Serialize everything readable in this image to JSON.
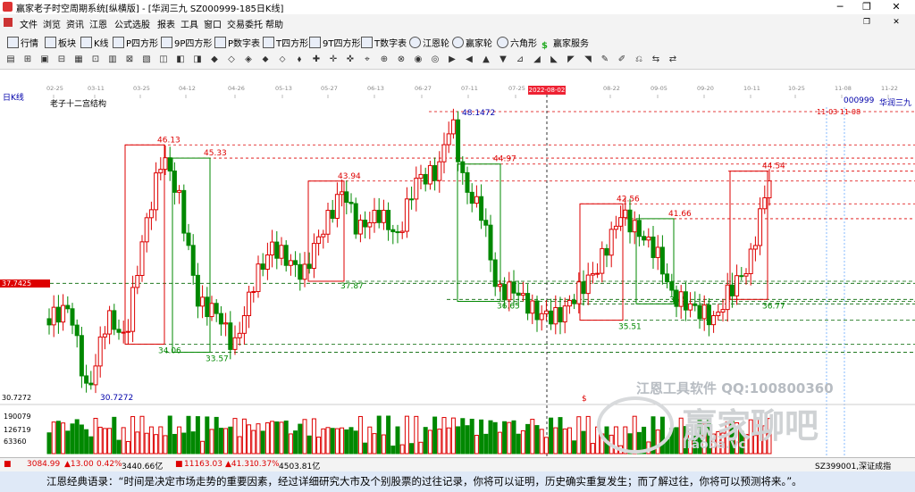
{
  "window": {
    "title": "赢家老子时空周期系统[纵横版] - [华润三九  SZ000999-185日K线]",
    "min_label": "─",
    "restore_label": "❐",
    "close_label": "✕"
  },
  "menu": [
    "文件",
    "浏览",
    "资讯",
    "江恩",
    "公式选股",
    "报表",
    "工具",
    "窗口",
    "交易委托",
    "帮助"
  ],
  "toolbar1": [
    "行情",
    "板块",
    "K线",
    "P四方形",
    "9P四方形",
    "P数字表",
    "T四方形",
    "9T四方形",
    "T数字表",
    "江恩轮",
    "赢家轮",
    "六角形",
    "赢家服务"
  ],
  "toolbar2_icons": [
    "grid-icon",
    "circle-icon",
    "square-icon",
    "digit-icon",
    "chart-icon",
    "cross-icon"
  ],
  "dates": [
    {
      "label": "02-25",
      "x": 60
    },
    {
      "label": "03-11",
      "x": 106
    },
    {
      "label": "03-25",
      "x": 157
    },
    {
      "label": "04-12",
      "x": 208
    },
    {
      "label": "04-26",
      "x": 263
    },
    {
      "label": "05-13",
      "x": 316
    },
    {
      "label": "05-27",
      "x": 367
    },
    {
      "label": "06-13",
      "x": 419
    },
    {
      "label": "06-27",
      "x": 472
    },
    {
      "label": "07-11",
      "x": 524
    },
    {
      "label": "07-25",
      "x": 577
    },
    {
      "label": "08-22",
      "x": 683
    },
    {
      "label": "09-05",
      "x": 736
    },
    {
      "label": "09-20",
      "x": 788
    },
    {
      "label": "10-11",
      "x": 840
    },
    {
      "label": "10-25",
      "x": 890
    },
    {
      "label": "11-08",
      "x": 942
    },
    {
      "label": "11-22",
      "x": 994
    }
  ],
  "current_date": "2022-08-02",
  "panel": {
    "period_label": "日K线",
    "indicator_label": "老子十二宫结构",
    "stock_code": "000999",
    "stock_name": "华润三九",
    "future_dates": "11-03  11-08"
  },
  "price_tag": "37.7425",
  "low_label": "30.7272",
  "volume_labels": [
    "190079",
    "126719",
    "63360"
  ],
  "annotations": [
    "46.13",
    "45.33",
    "43.94",
    "48.1472",
    "44.97",
    "42.56",
    "41.66",
    "44.54",
    "37.87",
    "36.65",
    "35.51",
    "36.5",
    "36.77",
    "34.06",
    "33.57"
  ],
  "dollar_mark": "$",
  "watermark": {
    "line1": "江恩工具软件  QQ:100800360",
    "line2": "赢家聊吧",
    "line3": "liaoba.vc"
  },
  "status": {
    "sh_index": "3084.99",
    "sh_change": "▲13.00",
    "sh_pct": "0.42%",
    "sh_amount": "3440.66亿",
    "sz_index": "11163.03",
    "sz_change": "▲41.31",
    "sz_pct": "0.37%",
    "sz_amount": "4503.81亿",
    "right_label": "SZ399001,深证成指"
  },
  "quote_text": "江恩经典语录：“时间是决定市场走势的重要因素，经过详细研究大市及个别股票的过往记录，你将可以证明，历史确实重复发生；而了解过往，你将可以预测将来。”。",
  "chart_data": {
    "type": "candlestick",
    "title": "老子十二宫结构",
    "period": "日K线",
    "stock": "华润三九 000999",
    "ylim": [
      30.7272,
      48.1472
    ],
    "levels": [
      {
        "value": 48.1472,
        "label": "48.1472"
      },
      {
        "value": 46.13,
        "label": "46.13"
      },
      {
        "value": 45.33,
        "label": "45.33"
      },
      {
        "value": 44.97,
        "label": "44.97"
      },
      {
        "value": 44.54,
        "label": "44.54"
      },
      {
        "value": 43.94,
        "label": "43.94"
      },
      {
        "value": 42.56,
        "label": "42.56"
      },
      {
        "value": 41.66,
        "label": "41.66"
      },
      {
        "value": 37.87,
        "label": "37.87"
      },
      {
        "value": 37.7425,
        "label": "37.7425"
      },
      {
        "value": 36.77,
        "label": "36.77"
      },
      {
        "value": 36.65,
        "label": "36.65"
      },
      {
        "value": 36.5,
        "label": "36.5"
      },
      {
        "value": 35.51,
        "label": "35.51"
      },
      {
        "value": 34.06,
        "label": "34.06"
      },
      {
        "value": 33.57,
        "label": "33.57"
      },
      {
        "value": 30.7272,
        "label": "30.7272"
      }
    ],
    "volume_ticks": [
      63360,
      126719,
      190079
    ]
  }
}
